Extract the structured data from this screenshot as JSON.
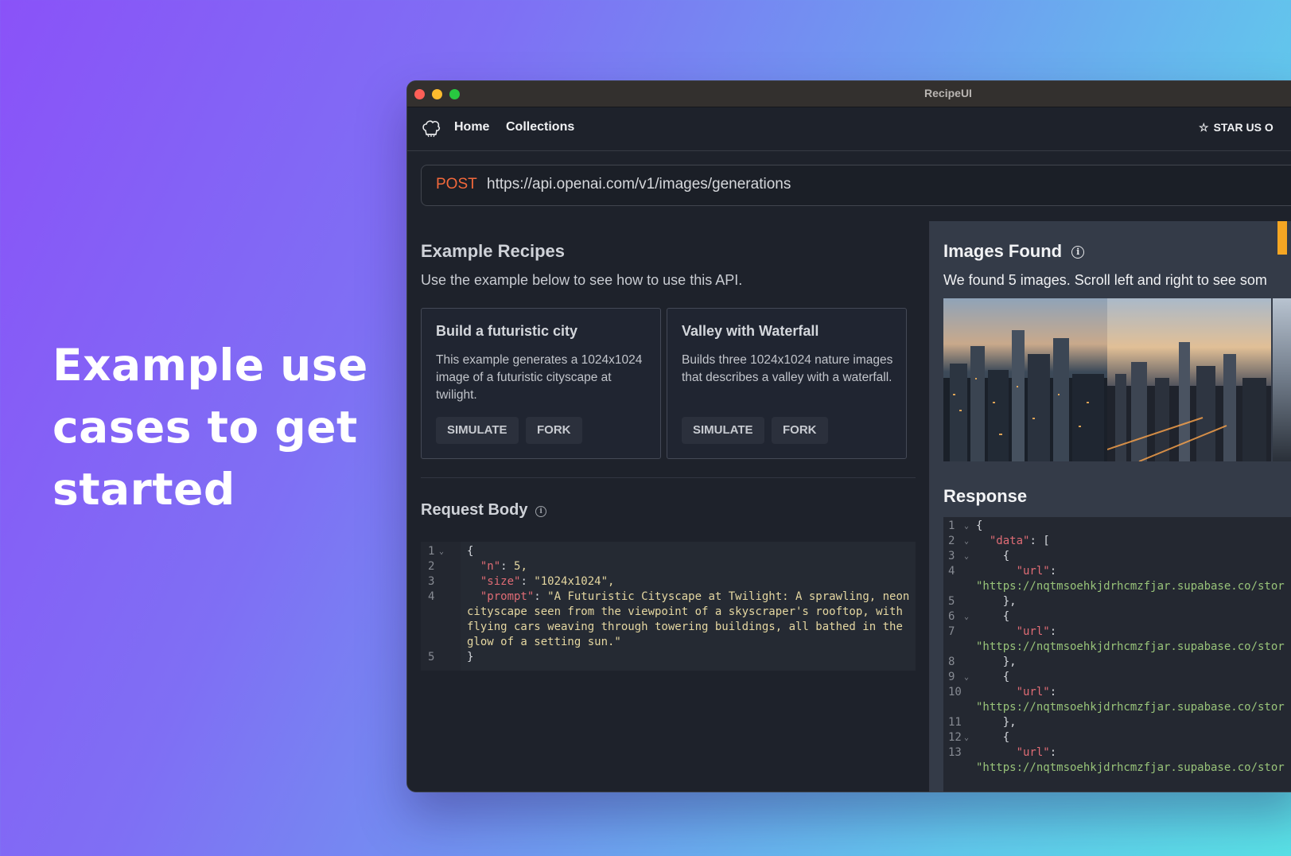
{
  "hero": {
    "line1": "Example use",
    "line2": "cases to get",
    "line3": "started"
  },
  "window": {
    "title": "RecipeUI"
  },
  "nav": {
    "home": "Home",
    "collections": "Collections",
    "star": "STAR US O",
    "logo_icon": "chef-hat-icon"
  },
  "request": {
    "method": "POST",
    "url": "https://api.openai.com/v1/images/generations"
  },
  "examples": {
    "title": "Example Recipes",
    "subtitle": "Use the example below to see how to use this API.",
    "cards": [
      {
        "title": "Build a futuristic city",
        "description": "This example generates a 1024x1024 image of a futuristic cityscape at twilight.",
        "simulate": "SIMULATE",
        "fork": "FORK"
      },
      {
        "title": "Valley with Waterfall",
        "description": "Builds three 1024x1024 nature images that describes a valley with a waterfall.",
        "simulate": "SIMULATE",
        "fork": "FORK"
      }
    ]
  },
  "request_body": {
    "title": "Request Body",
    "lines": [
      {
        "n": "1",
        "text": "{"
      },
      {
        "n": "2",
        "key": "\"n\"",
        "value": " 5,"
      },
      {
        "n": "3",
        "key": "\"size\"",
        "value": " \"1024x1024\","
      },
      {
        "n": "4",
        "key": "\"prompt\"",
        "value": " \"A Futuristic Cityscape at Twilight: A sprawling, neon"
      },
      {
        "n": "",
        "text": "cityscape seen from the viewpoint of a skyscraper's rooftop, with"
      },
      {
        "n": "",
        "text": "flying cars weaving through towering buildings, all bathed in the"
      },
      {
        "n": "",
        "text": "glow of a setting sun.\""
      },
      {
        "n": "5",
        "text": "}"
      }
    ]
  },
  "images": {
    "title": "Images Found",
    "subtitle": "We found 5 images. Scroll left and right to see som"
  },
  "response": {
    "title": "Response",
    "lines": [
      {
        "n": "1",
        "fold": true,
        "text": "{"
      },
      {
        "n": "2",
        "fold": true,
        "key": "\"data\"",
        "rest": ": ["
      },
      {
        "n": "3",
        "fold": true,
        "text": "    {"
      },
      {
        "n": "4",
        "key": "\"url\"",
        "rest": ":"
      },
      {
        "n": "",
        "url": "\"https://nqtmsoehkjdrhcmzfjar.supabase.co/stor"
      },
      {
        "n": "5",
        "text": "    },"
      },
      {
        "n": "6",
        "fold": true,
        "text": "    {"
      },
      {
        "n": "7",
        "key": "\"url\"",
        "rest": ":"
      },
      {
        "n": "",
        "url": "\"https://nqtmsoehkjdrhcmzfjar.supabase.co/stor"
      },
      {
        "n": "8",
        "text": "    },"
      },
      {
        "n": "9",
        "fold": true,
        "text": "    {"
      },
      {
        "n": "10",
        "key": "\"url\"",
        "rest": ":"
      },
      {
        "n": "",
        "url": "\"https://nqtmsoehkjdrhcmzfjar.supabase.co/stor"
      },
      {
        "n": "11",
        "text": "    },"
      },
      {
        "n": "12",
        "fold": true,
        "text": "    {"
      },
      {
        "n": "13",
        "key": "\"url\"",
        "rest": ":"
      },
      {
        "n": "",
        "url": "\"https://nqtmsoehkjdrhcmzfjar.supabase.co/stor"
      }
    ]
  },
  "colors": {
    "method": "#f2683b",
    "accent_orange": "#f5a623"
  }
}
